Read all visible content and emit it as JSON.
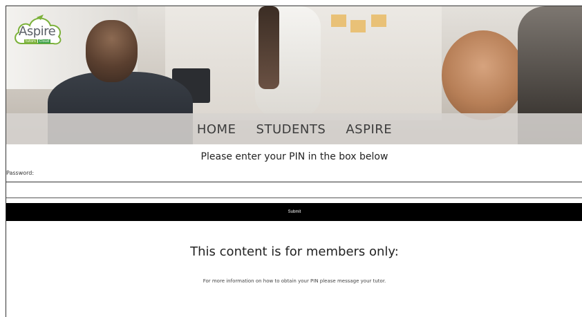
{
  "logo": {
    "name": "Aspire",
    "sub_left": "tutors",
    "sub_right": "Cloud"
  },
  "nav": {
    "items": [
      {
        "label": "HOME"
      },
      {
        "label": "STUDENTS"
      },
      {
        "label": "ASPIRE"
      }
    ]
  },
  "login": {
    "heading": "Please enter your PIN in the box below",
    "password_label": "Password:",
    "password_value": "",
    "submit_label": "Submit"
  },
  "members": {
    "heading": "This content is for members only:",
    "info": "For more information on how to obtain your PIN please message your tutor."
  },
  "colors": {
    "submit_bg": "#000000",
    "nav_text": "#3c3c3c",
    "logo_green": "#7bb13a"
  }
}
